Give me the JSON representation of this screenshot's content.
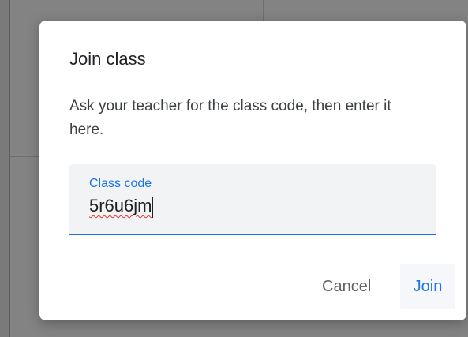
{
  "dialog": {
    "title": "Join class",
    "description": "Ask your teacher for the class code, then enter it here.",
    "field": {
      "label": "Class code",
      "value": "5r6u6jm"
    },
    "buttons": {
      "cancel": "Cancel",
      "join": "Join"
    }
  },
  "colors": {
    "accent": "#1a73e8",
    "field_background": "#f1f3f4",
    "spellcheck_underline": "#e53935"
  }
}
